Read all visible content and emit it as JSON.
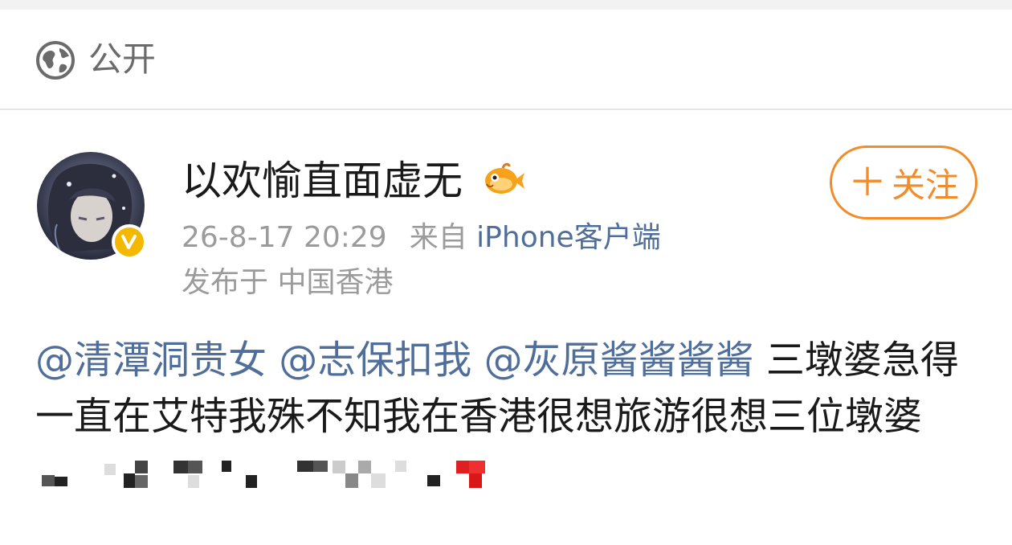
{
  "visibility": {
    "icon": "globe-icon",
    "label": "公开"
  },
  "post": {
    "username": "以欢愉直面虚无",
    "badge_icon": "fish-badge-icon",
    "verified_icon": "verified-v-icon",
    "follow_label": "关注",
    "follow_icon": "plus-icon",
    "datetime": "26-8-17 20:29",
    "source_prefix": "来自",
    "source_client": "iPhone客户端",
    "location": "发布于 中国香港",
    "mentions": [
      "@清潭洞贵女",
      "@志保扣我",
      "@灰原酱酱酱酱"
    ],
    "text_after_mentions": "三墩婆急得一直在艾特我殊不知我在香港很想旅游很想三位墩婆",
    "pixelated_emoji_icon": "pixelated-emoji-icon"
  },
  "colors": {
    "accent_orange": "#f08c2a",
    "link_blue": "#4f6e9a",
    "meta_gray": "#9b9b9b",
    "verified_yellow": "#f5b800"
  }
}
